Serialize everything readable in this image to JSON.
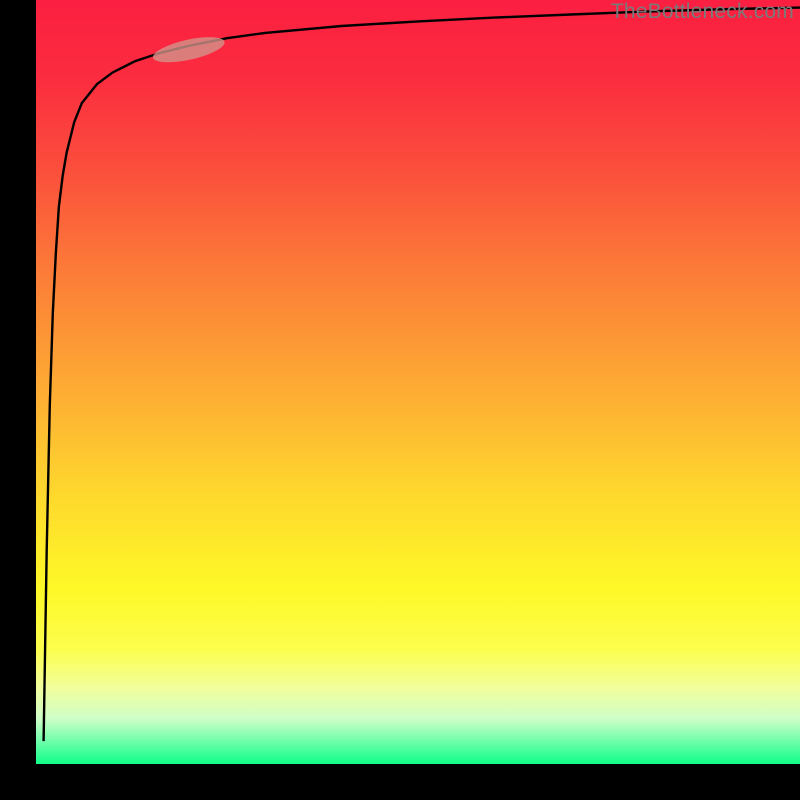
{
  "watermark": "TheBottleneck.com",
  "chart_data": {
    "type": "line",
    "title": "",
    "xlabel": "",
    "ylabel": "",
    "xlim": [
      0,
      100
    ],
    "ylim": [
      0,
      100
    ],
    "grid": false,
    "legend": false,
    "background_gradient": {
      "orientation": "vertical",
      "stops": [
        {
          "pos": 0.0,
          "color": "#fb1f41",
          "meaning": "severe-bottleneck"
        },
        {
          "pos": 0.5,
          "color": "#fdaf33",
          "meaning": "moderate-bottleneck"
        },
        {
          "pos": 0.8,
          "color": "#fef827",
          "meaning": "mild-bottleneck"
        },
        {
          "pos": 1.0,
          "color": "#10fe88",
          "meaning": "no-bottleneck"
        }
      ]
    },
    "series": [
      {
        "name": "bottleneck-curve",
        "x": [
          1.0,
          1.4,
          1.8,
          2.2,
          2.6,
          3.0,
          3.5,
          4.0,
          5.0,
          6.0,
          8.0,
          10,
          13,
          16,
          20,
          25,
          30,
          40,
          50,
          60,
          70,
          80,
          90,
          100
        ],
        "values": [
          3,
          28,
          47,
          59,
          67,
          73,
          77,
          80,
          84,
          86.5,
          89,
          90.5,
          92,
          93,
          94,
          95,
          95.7,
          96.6,
          97.2,
          97.7,
          98.1,
          98.5,
          98.8,
          99.0
        ]
      }
    ],
    "highlight_region": {
      "note": "selected operating point on curve",
      "x_range": [
        16,
        24
      ],
      "y_range": [
        92,
        95
      ]
    }
  }
}
